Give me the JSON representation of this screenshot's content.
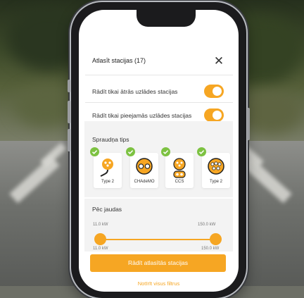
{
  "header": {
    "title": "Atlasīt stacijas (17)",
    "close_icon": "close-icon"
  },
  "filters": [
    {
      "label": "Rādīt tikai ātrās uzlādes stacijas",
      "enabled": true
    },
    {
      "label": "Rādīt tikai pieejamās uzlādes stacijas",
      "enabled": true
    }
  ],
  "plug_type": {
    "title": "Spraudņa tips",
    "items": [
      {
        "label": "Type 2",
        "icon": "type2-cable-icon",
        "selected": true
      },
      {
        "label": "CHAdeMO",
        "icon": "chademo-icon",
        "selected": true
      },
      {
        "label": "CCS",
        "icon": "ccs-icon",
        "selected": true
      },
      {
        "label": "Type  2",
        "icon": "type2-socket-icon",
        "selected": true
      }
    ]
  },
  "power": {
    "title": "Pēc jaudas",
    "min_top": "11.0 kW",
    "max_top": "150.0 kW",
    "min_bottom": "11.0 kW",
    "max_bottom": "150.0 kW"
  },
  "actions": {
    "apply": "Rādīt atlasītās stacijas",
    "clear": "Notīrīt visus filtrus"
  },
  "colors": {
    "accent": "#f6a623",
    "check": "#7dc242",
    "section_bg": "#f3f3f3"
  }
}
